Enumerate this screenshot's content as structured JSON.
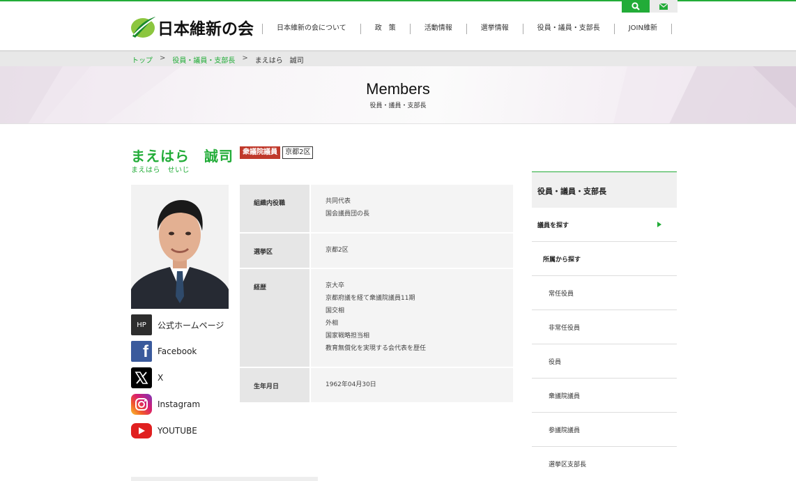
{
  "header": {
    "logo_text": "日本維新の会",
    "nav": [
      "日本維新の会について",
      "政　策",
      "活動情報",
      "選挙情報",
      "役員・議員・支部長",
      "JOIN維新"
    ],
    "icons": {
      "search": "search-icon",
      "mail": "mail-icon"
    },
    "accent": "#22ac38"
  },
  "breadcrumb": {
    "home": "トップ",
    "section": "役員・議員・支部長",
    "current": "まえはら　誠司",
    "sep": ">"
  },
  "hero": {
    "title": "Members",
    "subtitle": "役員・議員・支部長"
  },
  "profile": {
    "name": "まえはら　誠司",
    "kana": "まえはら　せいじ",
    "house_badge": "衆議院議員",
    "district_badge": "京都2区",
    "house_badge_color": "#c0392b"
  },
  "links": [
    {
      "icon": "HP",
      "label": "公式ホームページ"
    },
    {
      "icon": "facebook-icon",
      "label": "Facebook"
    },
    {
      "icon": "x-icon",
      "label": "X"
    },
    {
      "icon": "instagram-icon",
      "label": "Instagram"
    },
    {
      "icon": "youtube-icon",
      "label": "YOUTUBE"
    }
  ],
  "info": [
    {
      "label": "組織内役職",
      "lines": [
        "共同代表",
        "国会議員団の長"
      ]
    },
    {
      "label": "選挙区",
      "lines": [
        "京都2区"
      ]
    },
    {
      "label": "経歴",
      "lines": [
        "京大卒",
        "京都府議を経て衆議院議員11期",
        "国交相",
        "外相",
        "国家戦略担当相",
        "教育無償化を実現する会代表を歴任"
      ]
    },
    {
      "label": "生年月日",
      "lines": [
        "1962年04月30日"
      ]
    }
  ],
  "sidebar": {
    "heading": "役員・議員・支部長",
    "items": [
      {
        "label": "議員を探す",
        "level": 1
      },
      {
        "label": "所属から探す",
        "level": 2
      },
      {
        "label": "常任役員",
        "level": 3
      },
      {
        "label": "非常任役員",
        "level": 3
      },
      {
        "label": "役員",
        "level": 3
      },
      {
        "label": "衆議院議員",
        "level": 3
      },
      {
        "label": "参議院議員",
        "level": 3
      },
      {
        "label": "選挙区支部長",
        "level": 3
      }
    ]
  }
}
